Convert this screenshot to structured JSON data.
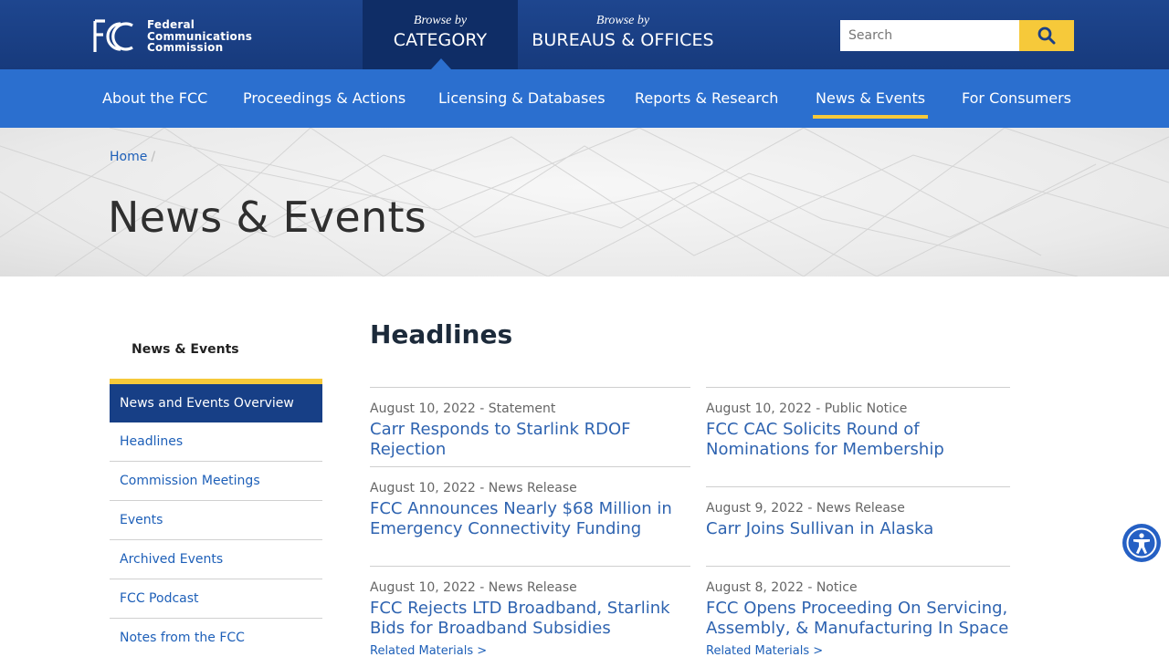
{
  "header": {
    "logo_text_line1": "Federal",
    "logo_text_line2": "Communications",
    "logo_text_line3": "Commission",
    "browse_category_by": "Browse by",
    "browse_category_label": "CATEGORY",
    "browse_bureaus_by": "Browse by",
    "browse_bureaus_label": "BUREAUS & OFFICES",
    "search_placeholder": "Search",
    "search_icon": "search-icon"
  },
  "nav": {
    "items": [
      {
        "label": "About the FCC"
      },
      {
        "label": "Proceedings & Actions"
      },
      {
        "label": "Licensing & Databases"
      },
      {
        "label": "Reports & Research"
      },
      {
        "label": "News & Events",
        "active": true
      },
      {
        "label": "For Consumers"
      }
    ]
  },
  "breadcrumb": {
    "home": "Home",
    "separator": "/"
  },
  "page": {
    "title": "News & Events"
  },
  "sidebar": {
    "title": "News & Events",
    "items": [
      {
        "label": "News and Events Overview",
        "active": true
      },
      {
        "label": "Headlines"
      },
      {
        "label": "Commission Meetings"
      },
      {
        "label": "Events"
      },
      {
        "label": "Archived Events"
      },
      {
        "label": "FCC Podcast"
      },
      {
        "label": "Notes from the FCC"
      }
    ]
  },
  "main": {
    "title": "Headlines",
    "left": [
      {
        "meta": "August 10, 2022 - Statement",
        "headline": "Carr Responds to Starlink RDOF Rejection"
      },
      {
        "meta": "August 10, 2022 - News Release",
        "headline": "FCC Announces Nearly $68 Million in Emergency Connectivity Funding"
      },
      {
        "meta": "August 10, 2022 - News Release",
        "headline": "FCC Rejects LTD Broadband, Starlink Bids for Broadband Subsidies",
        "related": "Related Materials >"
      }
    ],
    "right": [
      {
        "meta": "August 10, 2022 - Public Notice",
        "headline": "FCC CAC Solicits Round of Nominations for Membership"
      },
      {
        "meta": "August 9, 2022 - News Release",
        "headline": "Carr Joins Sullivan in Alaska"
      },
      {
        "meta": "August 8, 2022 - Notice",
        "headline": "FCC Opens Proceeding On Servicing, Assembly, & Manufacturing In Space",
        "related": "Related Materials >"
      }
    ]
  },
  "colors": {
    "header": "#1b3f86",
    "nav": "#2b6fcf",
    "accent": "#f6c93a",
    "link": "#2e63b0"
  },
  "accessibility": {
    "icon": "accessibility-icon"
  }
}
